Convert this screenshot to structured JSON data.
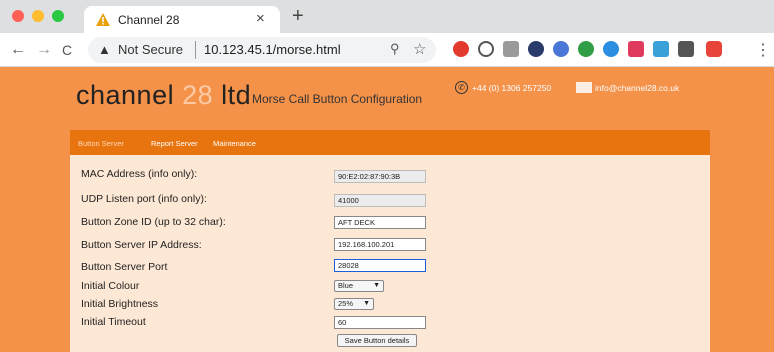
{
  "browser": {
    "tab_title": "Channel 28",
    "tab_close": "×",
    "new_tab": "+",
    "nav": {
      "back": "←",
      "forward": "→",
      "reload": "C"
    },
    "security_label": "Not Secure",
    "url": "10.123.45.1/morse.html"
  },
  "header": {
    "logo_word": "channel",
    "logo_number": "28",
    "logo_suffix": "ltd",
    "page_title": "Morse Call Button Configuration",
    "phone": "+44 (0) 1306 257250",
    "email": "info@channel28.co.uk"
  },
  "tabs": [
    {
      "label": "Button Server",
      "active": true
    },
    {
      "label": "Report Server",
      "active": false
    },
    {
      "label": "Maintenance",
      "active": false
    }
  ],
  "form": {
    "mac_address": {
      "label": "MAC Address (info only):",
      "value": "90:E2:02:87:90:3B"
    },
    "udp_port": {
      "label": "UDP Listen port (info only):",
      "value": "41000"
    },
    "zone_id": {
      "label": "Button Zone ID (up to 32 char):",
      "value": "AFT DECK"
    },
    "server_ip": {
      "label": "Button Server IP Address:",
      "value": "192.168.100.201"
    },
    "server_port": {
      "label": "Button Server Port",
      "value": "28028"
    },
    "initial_colour": {
      "label": "Initial Colour",
      "value": "Blue"
    },
    "initial_brightness": {
      "label": "Initial Brightness",
      "value": "25%"
    },
    "initial_timeout": {
      "label": "Initial Timeout",
      "value": "60"
    },
    "save_label": "Save Button details"
  },
  "colors": {
    "page_background": "#f5924a",
    "tab_strip": "#e8740f",
    "panel_background": "#fde8d5",
    "focus_outline": "#1f5fd6"
  }
}
